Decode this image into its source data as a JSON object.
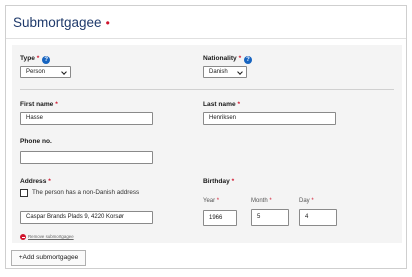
{
  "card": {
    "title": "Submortgagee",
    "required_marker": "•"
  },
  "form": {
    "type": {
      "label": "Type",
      "required": "*",
      "help_icon": "?",
      "value": "Person"
    },
    "nationality": {
      "label": "Nationality",
      "required": "*",
      "help_icon": "?",
      "value": "Danish"
    },
    "first_name": {
      "label": "First name",
      "required": "*",
      "value": "Hasse"
    },
    "last_name": {
      "label": "Last name",
      "required": "*",
      "value": "Henriksen"
    },
    "phone": {
      "label": "Phone no.",
      "value": ""
    },
    "address": {
      "label": "Address",
      "required": "*",
      "non_danish_label": "The person has a non-Danish address",
      "non_danish_checked": false,
      "value": "Caspar Brands Plads 9, 4220 Korsør"
    },
    "birthday": {
      "label": "Birthday",
      "required": "*",
      "year": {
        "label": "Year",
        "required": "*",
        "value": "1966"
      },
      "month": {
        "label": "Month",
        "required": "*",
        "value": "5"
      },
      "day": {
        "label": "Day",
        "required": "*",
        "value": "4"
      }
    },
    "remove_label": "Remove submortgagee"
  },
  "add_button_label": "+Add submortgagee",
  "icons": {
    "help": "help-circle-icon",
    "remove": "minus-circle-icon",
    "chevron": "chevron-down-icon"
  },
  "colors": {
    "accent": "#1764c0",
    "required": "#d0142c",
    "title": "#1f3a6b",
    "panel": "#f4f4f4"
  }
}
